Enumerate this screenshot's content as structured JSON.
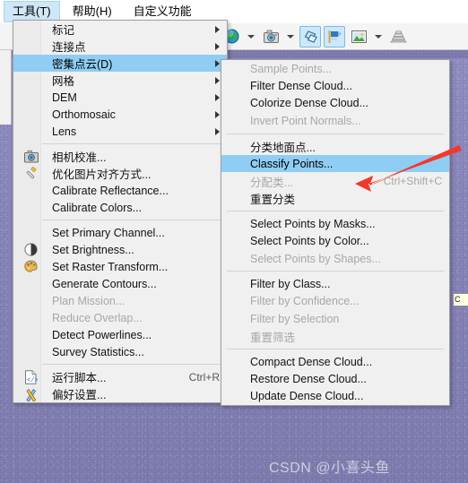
{
  "window": {
    "watermark": "CSDN @小喜头鱼"
  },
  "menubar": {
    "items": [
      {
        "label": "工具(T)",
        "mnemonic": "T",
        "active": true
      },
      {
        "label": "帮助(H)",
        "mnemonic": "H",
        "active": false
      },
      {
        "label": "自定义功能",
        "mnemonic": "",
        "active": false
      }
    ]
  },
  "toolbar": {
    "buttons": [
      {
        "name": "globe-icon",
        "label": "",
        "selected": false,
        "dropdown": true
      },
      {
        "name": "camera-icon",
        "label": "",
        "selected": false,
        "dropdown": true
      },
      {
        "name": "shapes-icon",
        "label": "",
        "selected": true,
        "dropdown": false
      },
      {
        "name": "flag-icon",
        "label": "",
        "selected": true,
        "dropdown": false
      },
      {
        "name": "image-icon",
        "label": "",
        "selected": false,
        "dropdown": true
      },
      {
        "name": "print-icon",
        "label": "",
        "selected": false,
        "dropdown": false
      }
    ]
  },
  "tools_menu": {
    "items": [
      {
        "label": "标记",
        "submenu": true,
        "disabled": false,
        "icon": "",
        "accel": "",
        "highlight": false
      },
      {
        "label": "连接点",
        "submenu": true,
        "disabled": false,
        "icon": "",
        "accel": "",
        "highlight": false
      },
      {
        "label": "密集点云(D)",
        "submenu": true,
        "disabled": false,
        "icon": "",
        "accel": "",
        "highlight": true
      },
      {
        "label": "网格",
        "submenu": true,
        "disabled": false,
        "icon": "",
        "accel": "",
        "highlight": false
      },
      {
        "label": "DEM",
        "submenu": true,
        "disabled": false,
        "icon": "",
        "accel": "",
        "highlight": false
      },
      {
        "label": "Orthomosaic",
        "submenu": true,
        "disabled": false,
        "icon": "",
        "accel": "",
        "highlight": false
      },
      {
        "label": "Lens",
        "submenu": true,
        "disabled": false,
        "icon": "",
        "accel": "",
        "highlight": false
      },
      {
        "separator": true
      },
      {
        "label": "相机校准...",
        "submenu": false,
        "disabled": false,
        "icon": "camera-calibration-icon",
        "accel": "",
        "highlight": false
      },
      {
        "label": "优化图片对齐方式...",
        "submenu": false,
        "disabled": false,
        "icon": "magic-wand-icon",
        "accel": "",
        "highlight": false
      },
      {
        "label": "Calibrate Reflectance...",
        "submenu": false,
        "disabled": false,
        "icon": "",
        "accel": "",
        "highlight": false
      },
      {
        "label": "Calibrate Colors...",
        "submenu": false,
        "disabled": false,
        "icon": "",
        "accel": "",
        "highlight": false
      },
      {
        "separator": true
      },
      {
        "label": "Set Primary Channel...",
        "submenu": false,
        "disabled": false,
        "icon": "",
        "accel": "",
        "highlight": false
      },
      {
        "label": "Set Brightness...",
        "submenu": false,
        "disabled": false,
        "icon": "brightness-icon",
        "accel": "",
        "highlight": false
      },
      {
        "label": "Set Raster Transform...",
        "submenu": false,
        "disabled": false,
        "icon": "palette-icon",
        "accel": "",
        "highlight": false
      },
      {
        "label": "Generate Contours...",
        "submenu": false,
        "disabled": false,
        "icon": "",
        "accel": "",
        "highlight": false
      },
      {
        "label": "Plan Mission...",
        "submenu": false,
        "disabled": true,
        "icon": "",
        "accel": "",
        "highlight": false
      },
      {
        "label": "Reduce Overlap...",
        "submenu": false,
        "disabled": true,
        "icon": "",
        "accel": "",
        "highlight": false
      },
      {
        "label": "Detect Powerlines...",
        "submenu": false,
        "disabled": false,
        "icon": "",
        "accel": "",
        "highlight": false
      },
      {
        "label": "Survey Statistics...",
        "submenu": false,
        "disabled": false,
        "icon": "",
        "accel": "",
        "highlight": false
      },
      {
        "separator": true
      },
      {
        "label": "运行脚本...",
        "submenu": false,
        "disabled": false,
        "icon": "script-icon",
        "accel": "Ctrl+R",
        "highlight": false
      },
      {
        "label": "偏好设置...",
        "submenu": false,
        "disabled": false,
        "icon": "preferences-icon",
        "accel": "",
        "highlight": false
      }
    ]
  },
  "dense_cloud_submenu": {
    "items": [
      {
        "label": "Sample Points...",
        "disabled": true,
        "accel": "",
        "highlight": false
      },
      {
        "label": "Filter Dense Cloud...",
        "disabled": false,
        "accel": "",
        "highlight": false
      },
      {
        "label": "Colorize Dense Cloud...",
        "disabled": false,
        "accel": "",
        "highlight": false
      },
      {
        "label": "Invert Point Normals...",
        "disabled": true,
        "accel": "",
        "highlight": false
      },
      {
        "separator": true
      },
      {
        "label": "分类地面点...",
        "disabled": false,
        "accel": "",
        "highlight": false
      },
      {
        "label": "Classify Points...",
        "disabled": false,
        "accel": "",
        "highlight": true
      },
      {
        "label": "分配类...",
        "disabled": true,
        "accel": "Ctrl+Shift+C",
        "highlight": false
      },
      {
        "label": "重置分类",
        "disabled": false,
        "accel": "",
        "highlight": false
      },
      {
        "separator": true
      },
      {
        "label": "Select Points by Masks...",
        "disabled": false,
        "accel": "",
        "highlight": false
      },
      {
        "label": "Select Points by Color...",
        "disabled": false,
        "accel": "",
        "highlight": false
      },
      {
        "label": "Select Points by Shapes...",
        "disabled": true,
        "accel": "",
        "highlight": false
      },
      {
        "separator": true
      },
      {
        "label": "Filter by Class...",
        "disabled": false,
        "accel": "",
        "highlight": false
      },
      {
        "label": "Filter by Confidence...",
        "disabled": true,
        "accel": "",
        "highlight": false
      },
      {
        "label": "Filter by Selection",
        "disabled": true,
        "accel": "",
        "highlight": false
      },
      {
        "label": "重置筛选",
        "disabled": true,
        "accel": "",
        "highlight": false
      },
      {
        "separator": true
      },
      {
        "label": "Compact Dense Cloud...",
        "disabled": false,
        "accel": "",
        "highlight": false
      },
      {
        "label": "Restore Dense Cloud...",
        "disabled": false,
        "accel": "",
        "highlight": false
      },
      {
        "label": "Update Dense Cloud...",
        "disabled": false,
        "accel": "",
        "highlight": false
      }
    ]
  },
  "annotation": {
    "arrow_color": "#f2382c",
    "points_to": "Classify Points..."
  },
  "colors": {
    "highlight": "#90cdf4",
    "menu_bg": "#f0f0f0",
    "viewport": "#8481b6"
  },
  "tooltip_fragment": {
    "text": "C"
  }
}
